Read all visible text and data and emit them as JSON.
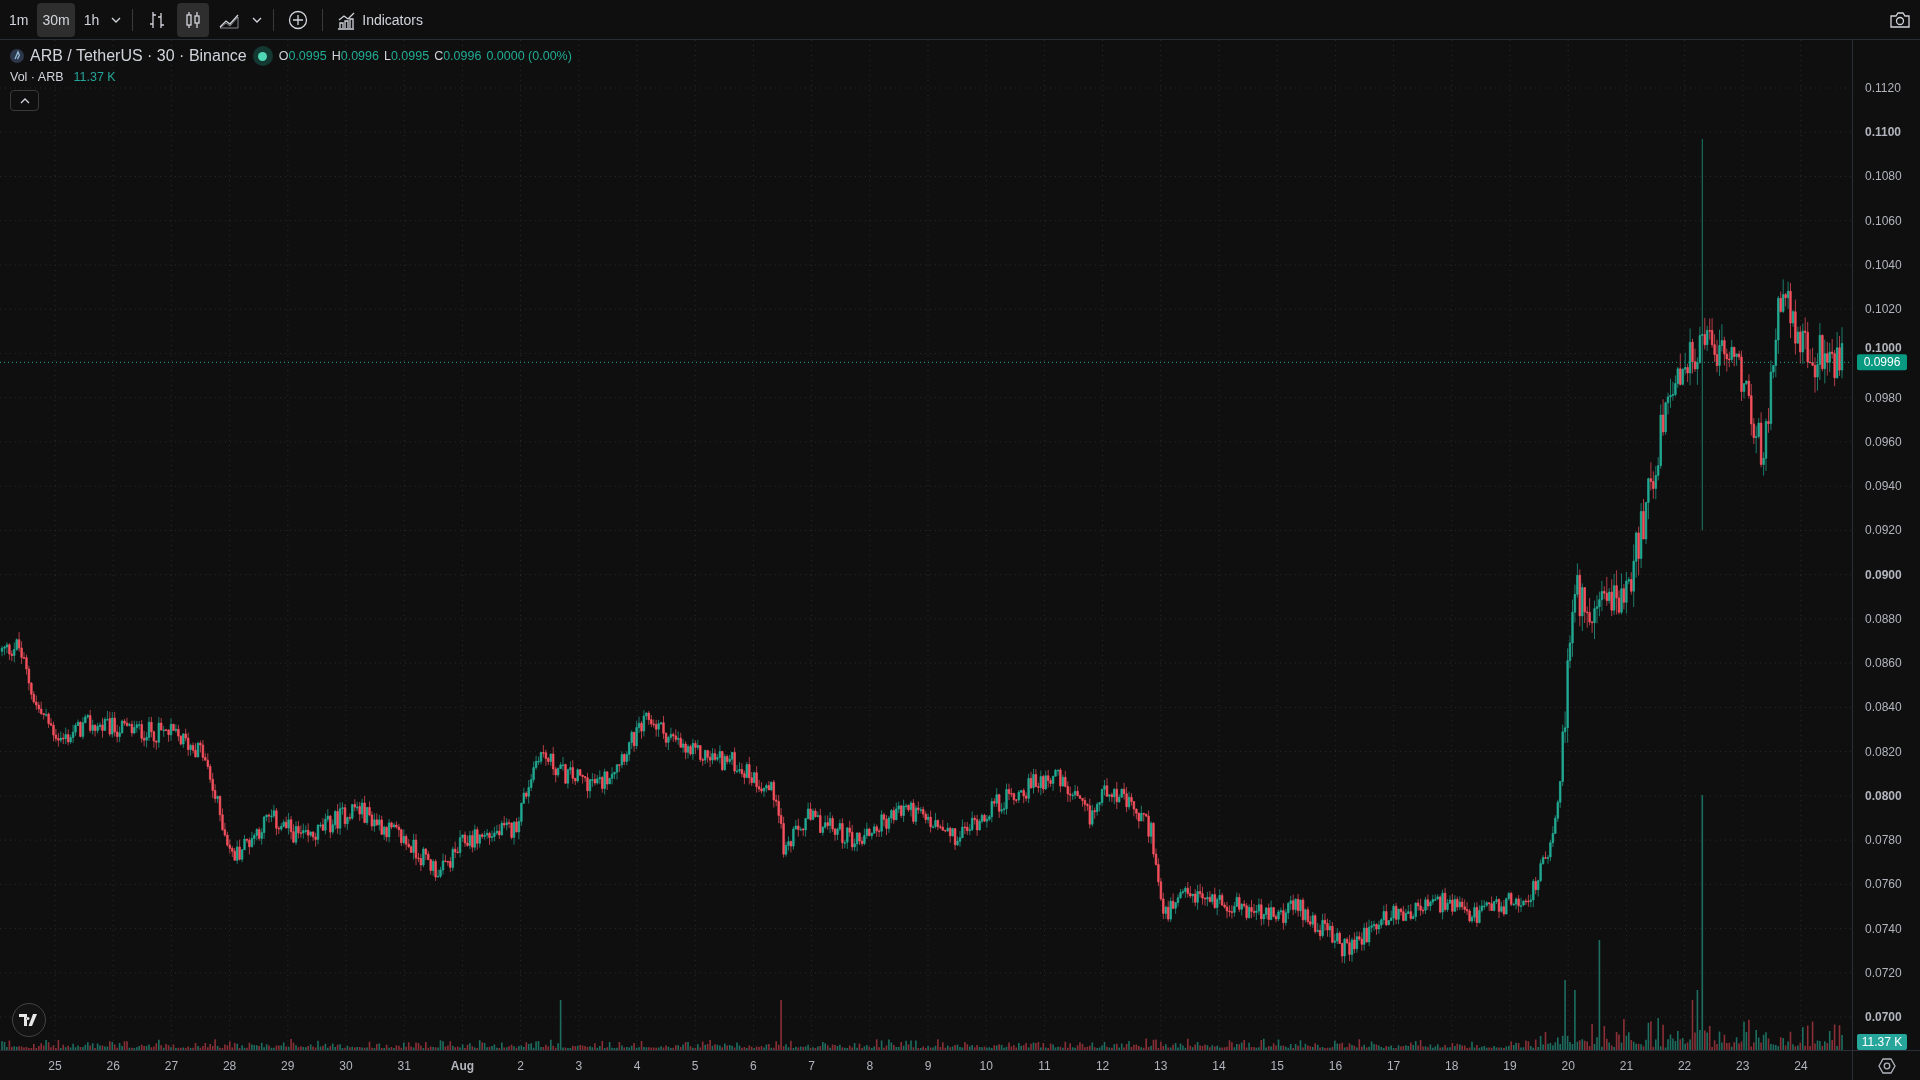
{
  "toolbar": {
    "intervals": [
      {
        "label": "1m",
        "selected": false
      },
      {
        "label": "30m",
        "selected": true
      },
      {
        "label": "1h",
        "selected": false
      }
    ],
    "chart_types": [
      {
        "kind": "bars",
        "selected": false
      },
      {
        "kind": "candles",
        "selected": true
      },
      {
        "kind": "area",
        "selected": false
      }
    ],
    "indicators_label": "Indicators"
  },
  "legend": {
    "symbol": "ARB / TetherUS · 30 · Binance",
    "ohlc": [
      {
        "key": "O",
        "value": "0.0995"
      },
      {
        "key": "H",
        "value": "0.0996"
      },
      {
        "key": "L",
        "value": "0.0995"
      },
      {
        "key": "C",
        "value": "0.0996"
      }
    ],
    "change": "0.0000 (0.00%)",
    "volume_label": "Vol · ARB",
    "volume_value": "11.37 K"
  },
  "price_axis": {
    "ticks": [
      {
        "label": "0.1120",
        "major": false
      },
      {
        "label": "0.1100",
        "major": true
      },
      {
        "label": "0.1080",
        "major": false
      },
      {
        "label": "0.1060",
        "major": false
      },
      {
        "label": "0.1040",
        "major": false
      },
      {
        "label": "0.1020",
        "major": false
      },
      {
        "label": "0.1000",
        "major": true
      },
      {
        "label": "0.0980",
        "major": false
      },
      {
        "label": "0.0960",
        "major": false
      },
      {
        "label": "0.0940",
        "major": false
      },
      {
        "label": "0.0920",
        "major": false
      },
      {
        "label": "0.0900",
        "major": true
      },
      {
        "label": "0.0880",
        "major": false
      },
      {
        "label": "0.0860",
        "major": false
      },
      {
        "label": "0.0840",
        "major": false
      },
      {
        "label": "0.0820",
        "major": false
      },
      {
        "label": "0.0800",
        "major": true
      },
      {
        "label": "0.0780",
        "major": false
      },
      {
        "label": "0.0760",
        "major": false
      },
      {
        "label": "0.0740",
        "major": false
      },
      {
        "label": "0.0720",
        "major": false
      },
      {
        "label": "0.0700",
        "major": true
      }
    ],
    "current_price": "0.0996",
    "volume_badge": "11.37 K"
  },
  "time_axis": {
    "labels": [
      {
        "label": "25",
        "major": false
      },
      {
        "label": "26",
        "major": false
      },
      {
        "label": "27",
        "major": false
      },
      {
        "label": "28",
        "major": false
      },
      {
        "label": "29",
        "major": false
      },
      {
        "label": "30",
        "major": false
      },
      {
        "label": "31",
        "major": false
      },
      {
        "label": "Aug",
        "major": true
      },
      {
        "label": "2",
        "major": false
      },
      {
        "label": "3",
        "major": false
      },
      {
        "label": "4",
        "major": false
      },
      {
        "label": "5",
        "major": false
      },
      {
        "label": "6",
        "major": false
      },
      {
        "label": "7",
        "major": false
      },
      {
        "label": "8",
        "major": false
      },
      {
        "label": "9",
        "major": false
      },
      {
        "label": "10",
        "major": false
      },
      {
        "label": "11",
        "major": false
      },
      {
        "label": "12",
        "major": false
      },
      {
        "label": "13",
        "major": false
      },
      {
        "label": "14",
        "major": false
      },
      {
        "label": "15",
        "major": false
      },
      {
        "label": "16",
        "major": false
      },
      {
        "label": "17",
        "major": false
      },
      {
        "label": "18",
        "major": false
      },
      {
        "label": "19",
        "major": false
      },
      {
        "label": "20",
        "major": false
      },
      {
        "label": "21",
        "major": false
      },
      {
        "label": "22",
        "major": false
      },
      {
        "label": "23",
        "major": false
      },
      {
        "label": "24",
        "major": false
      }
    ]
  }
}
